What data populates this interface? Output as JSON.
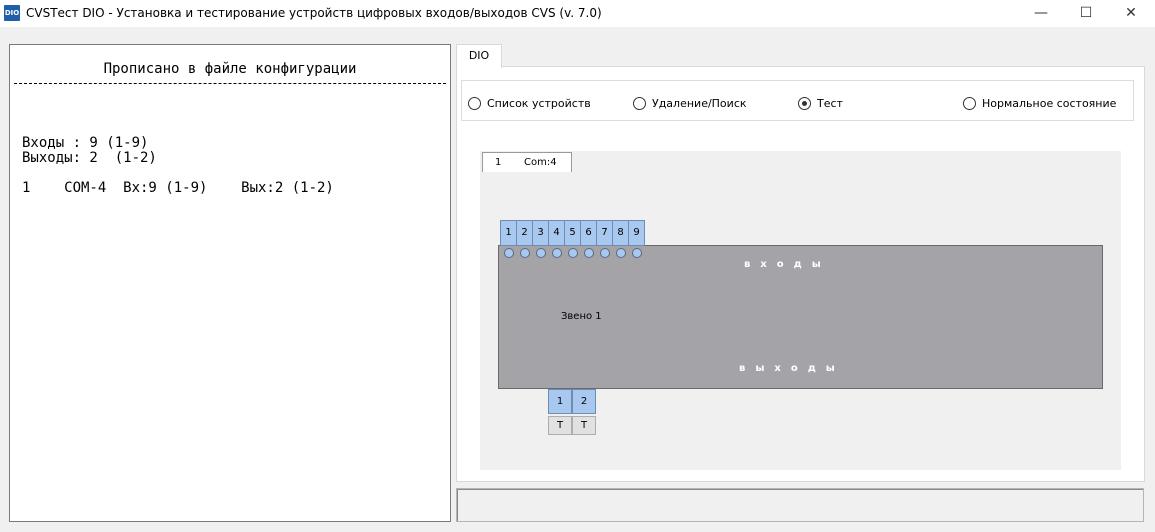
{
  "window": {
    "title": "CVSТест DIO - Установка и тестирование устройств цифровых входов/выходов  CVS (v. 7.0)",
    "icon_text": "DIO",
    "minimize": "—",
    "maximize": "☐",
    "close": "✕"
  },
  "config_panel": {
    "title": "Прописано в файле конфигурации",
    "inputs_line": "Входы : 9 (1-9)",
    "outputs_line": "Выходы: 2  (1-2)",
    "device_line": "1    COM-4  Вх:9 (1-9)    Вых:2 (1-2)"
  },
  "tabs": [
    {
      "label": "DIO"
    }
  ],
  "modes": [
    {
      "label": "Список устройств",
      "checked": false
    },
    {
      "label": "Удаление/Поиск",
      "checked": false
    },
    {
      "label": "Тест",
      "checked": true
    },
    {
      "label": "Нормальное состояние",
      "checked": false
    }
  ],
  "device_tab": {
    "number": "1",
    "port": "Com:4"
  },
  "module": {
    "inputs_label": "входы",
    "outputs_label": "выходы",
    "link_label": "Звено 1",
    "inputs": [
      "1",
      "2",
      "3",
      "4",
      "5",
      "6",
      "7",
      "8",
      "9"
    ],
    "outputs": [
      "1",
      "2"
    ],
    "output_buttons": [
      "T",
      "T"
    ]
  }
}
